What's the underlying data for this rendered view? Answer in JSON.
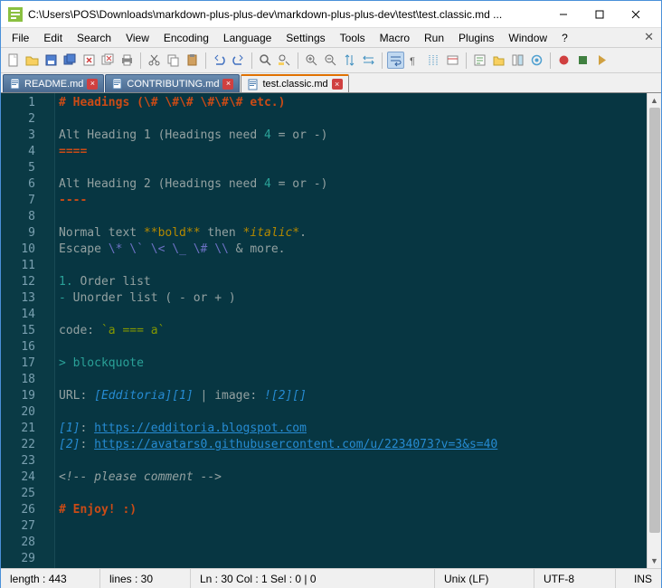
{
  "titlebar": {
    "text": "C:\\Users\\POS\\Downloads\\markdown-plus-plus-dev\\markdown-plus-plus-dev\\test\\test.classic.md ..."
  },
  "menu": {
    "items": [
      "File",
      "Edit",
      "Search",
      "View",
      "Encoding",
      "Language",
      "Settings",
      "Tools",
      "Macro",
      "Run",
      "Plugins",
      "Window",
      "?"
    ]
  },
  "tabs": [
    {
      "label": "README.md",
      "active": false
    },
    {
      "label": "CONTRIBUTING.md",
      "active": false
    },
    {
      "label": "test.classic.md",
      "active": true
    }
  ],
  "lines": [
    [
      {
        "t": "# Headings (\\# \\#\\# \\#\\#\\# etc.)",
        "c": "c-orange"
      }
    ],
    [],
    [
      {
        "t": "Alt Heading 1 (Headings need ",
        "c": "c-gray"
      },
      {
        "t": "4",
        "c": "c-cyan"
      },
      {
        "t": " = or -)",
        "c": "c-gray"
      }
    ],
    [
      {
        "t": "====",
        "c": "c-orange"
      }
    ],
    [],
    [
      {
        "t": "Alt Heading 2 (Headings need ",
        "c": "c-gray"
      },
      {
        "t": "4",
        "c": "c-cyan"
      },
      {
        "t": " = or -)",
        "c": "c-gray"
      }
    ],
    [
      {
        "t": "----",
        "c": "c-orange"
      }
    ],
    [],
    [
      {
        "t": "Normal text ",
        "c": "c-gray"
      },
      {
        "t": "**bold**",
        "c": "c-yellow"
      },
      {
        "t": " then ",
        "c": "c-gray"
      },
      {
        "t": "*italic*",
        "c": "c-yellow italic"
      },
      {
        "t": ".",
        "c": "c-gray"
      }
    ],
    [
      {
        "t": "Escape ",
        "c": "c-gray"
      },
      {
        "t": "\\* \\` \\< \\_ \\# \\\\",
        "c": "c-violet"
      },
      {
        "t": " & more.",
        "c": "c-gray"
      }
    ],
    [],
    [
      {
        "t": "1.",
        "c": "c-cyan"
      },
      {
        "t": " Order list",
        "c": "c-gray"
      }
    ],
    [
      {
        "t": "-",
        "c": "c-cyan"
      },
      {
        "t": " Unorder list ( - or + )",
        "c": "c-gray"
      }
    ],
    [],
    [
      {
        "t": "code: ",
        "c": "c-gray"
      },
      {
        "t": "`a === a`",
        "c": "c-green"
      }
    ],
    [],
    [
      {
        "t": "> blockquote",
        "c": "c-cyan"
      }
    ],
    [],
    [
      {
        "t": "URL: ",
        "c": "c-gray"
      },
      {
        "t": "[Edditoria][1]",
        "c": "c-blue italic"
      },
      {
        "t": " | image: ",
        "c": "c-gray"
      },
      {
        "t": "![2][]",
        "c": "c-blue italic"
      }
    ],
    [],
    [
      {
        "t": "[1]",
        "c": "c-blue italic"
      },
      {
        "t": ": ",
        "c": "c-gray"
      },
      {
        "t": "https://edditoria.blogspot.com",
        "c": "c-blue underline"
      }
    ],
    [
      {
        "t": "[2]",
        "c": "c-blue italic"
      },
      {
        "t": ": ",
        "c": "c-gray"
      },
      {
        "t": "https://avatars0.githubusercontent.com/u/2234073?v=3&s=40",
        "c": "c-blue underline"
      }
    ],
    [],
    [
      {
        "t": "<!-- please comment -->",
        "c": "c-gray italic"
      }
    ],
    [],
    [
      {
        "t": "# Enjoy! :)",
        "c": "c-orange"
      }
    ],
    [],
    [],
    []
  ],
  "status": {
    "length": "length : 443",
    "lines": "lines : 30",
    "pos": "Ln : 30    Col : 1    Sel : 0 | 0",
    "eol": "Unix (LF)",
    "enc": "UTF-8",
    "ins": "INS"
  }
}
